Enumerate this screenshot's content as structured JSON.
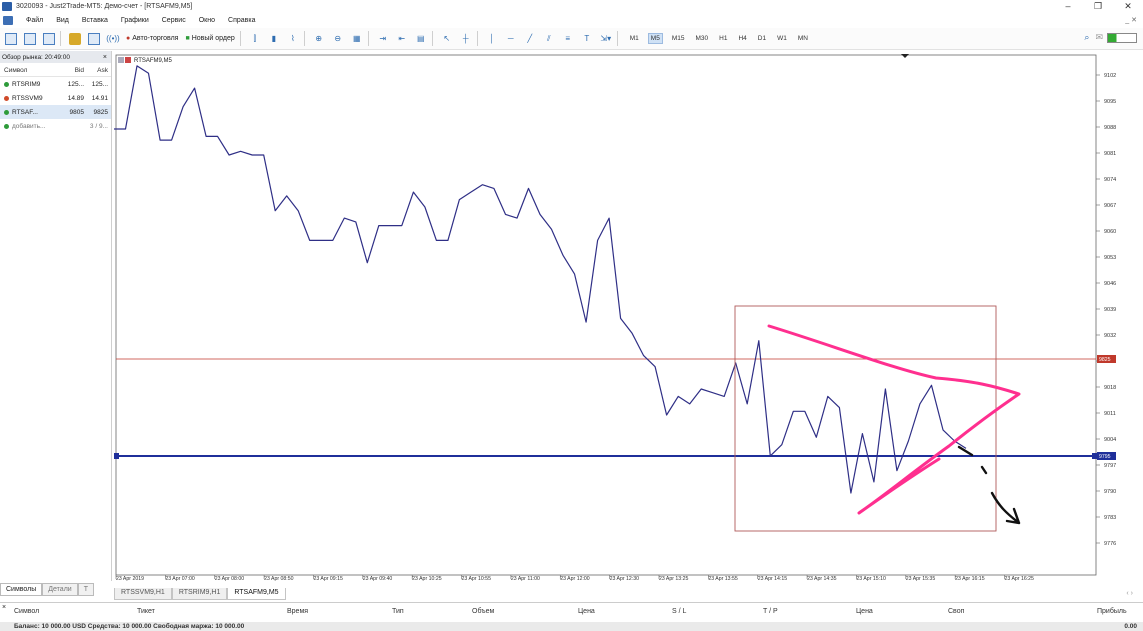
{
  "window": {
    "title": "3020093 - Just2Trade-MT5: Демо-счет - [RTSAFM9,M5]",
    "min": "–",
    "max": "❐",
    "close": "✕"
  },
  "menu": {
    "items": [
      "Файл",
      "Вид",
      "Вставка",
      "Графики",
      "Сервис",
      "Окно",
      "Справка"
    ],
    "doc_buttons": "_ ✕"
  },
  "toolbar": {
    "autotrade_label": "Авто-торговля",
    "new_order_label": "Новый ордер",
    "timeframes": [
      "M1",
      "M5",
      "M15",
      "M30",
      "H1",
      "H4",
      "D1",
      "W1",
      "MN"
    ],
    "active_timeframe": "M5"
  },
  "market_watch": {
    "title": "Обзор рынка: 20:49:00",
    "close": "×",
    "columns": {
      "symbol": "Символ",
      "bid": "Bid",
      "ask": "Ask"
    },
    "rows": [
      {
        "symbol": "RTSRIM9",
        "bid": "125...",
        "ask": "125...",
        "color": "#2e9b3a"
      },
      {
        "symbol": "RTSSVM9",
        "bid": "14.89",
        "ask": "14.91",
        "color": "#d04a2a"
      },
      {
        "symbol": "RTSAF...",
        "bid": "9805",
        "ask": "9825",
        "color": "#2e9b3a"
      },
      {
        "symbol": "добавить...",
        "bid": "",
        "ask": "3 / 9...",
        "color": "#2e9b3a"
      }
    ],
    "tabs": [
      "Символы",
      "Детали",
      "Т"
    ]
  },
  "chart": {
    "symbol_label": "RTSAFM9,M5",
    "price_ticks": [
      "9102",
      "9095",
      "9088",
      "9081",
      "9074",
      "9067",
      "9060",
      "9053",
      "9046",
      "9039",
      "9032",
      "9025",
      "9018",
      "9011",
      "9004",
      "9797",
      "9790",
      "9783",
      "9776"
    ],
    "time_ticks": [
      "23 Apr 2019",
      "23 Apr 07:00",
      "23 Apr 08:00",
      "23 Apr 08:50",
      "23 Apr 09:15",
      "23 Apr 09:40",
      "23 Apr 10:25",
      "23 Apr 10:55",
      "23 Apr 11:00",
      "23 Apr 12:00",
      "23 Apr 12:30",
      "23 Apr 13:25",
      "23 Apr 13:55",
      "23 Apr 14:15",
      "23 Apr 14:35",
      "23 Apr 15:10",
      "23 Apr 15:35",
      "23 Apr 16:15",
      "23 Apr 16:25"
    ],
    "ask_label": "9825",
    "bid_label": "9795",
    "line_color": "#2f2f86",
    "ask_line_color": "#c0392b",
    "bid_line_color": "#1f2f9a",
    "annotation_color": "#ff2f8f",
    "prices": [
      9088,
      9088,
      9105,
      9103,
      9085,
      9085,
      9094,
      9099,
      9086,
      9086,
      9081,
      9082,
      9081,
      9081,
      9066,
      9070,
      9066,
      9058,
      9058,
      9058,
      9064,
      9063,
      9052,
      9062,
      9062,
      9062,
      9071,
      9067,
      9058,
      9058,
      9069,
      9071,
      9073,
      9072,
      9065,
      9064,
      9072,
      9065,
      9061,
      9054,
      9049,
      9036,
      9058,
      9064,
      9037,
      9033,
      9027,
      9024,
      9011,
      9016,
      9014,
      9018,
      9017,
      9016,
      9025,
      9014,
      9031,
      9000,
      9003,
      9012,
      9012,
      9005,
      9016,
      9013,
      8990,
      9006,
      8993,
      9018,
      8996,
      9004,
      9014,
      9019,
      9007,
      9004,
      9002
    ]
  },
  "chart_tabs": [
    "RTSSVM9,H1",
    "RTSRIM9,H1",
    "RTSAFM9,M5"
  ],
  "chart_tabs_nav": "‹ ›",
  "terminal": {
    "close": "×",
    "columns": [
      "Символ",
      "Тикет",
      "Время",
      "Тип",
      "Объем",
      "Цена",
      "S / L",
      "T / P",
      "Цена",
      "Своп",
      "Прибыль"
    ],
    "balance_text": "Баланс: 10 000.00 USD  Средства: 10 000.00  Свободная маржа: 10 000.00",
    "balance_value": "0.00"
  }
}
